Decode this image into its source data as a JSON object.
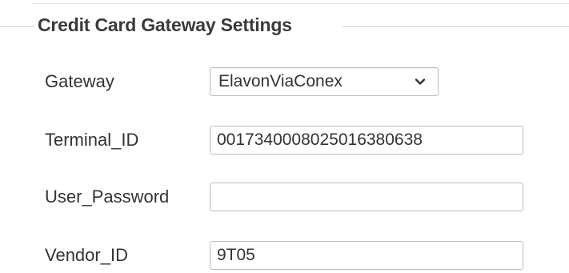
{
  "section": {
    "legend": "Credit Card Gateway Settings"
  },
  "fields": {
    "gateway": {
      "label": "Gateway",
      "selected": "ElavonViaConex"
    },
    "terminal_id": {
      "label": "Terminal_ID",
      "value": "0017340008025016380638"
    },
    "user_password": {
      "label": "User_Password",
      "value": ""
    },
    "vendor_id": {
      "label": "Vendor_ID",
      "value": "9T05"
    }
  },
  "icons": {
    "dropdown": "chevron-down-icon"
  }
}
